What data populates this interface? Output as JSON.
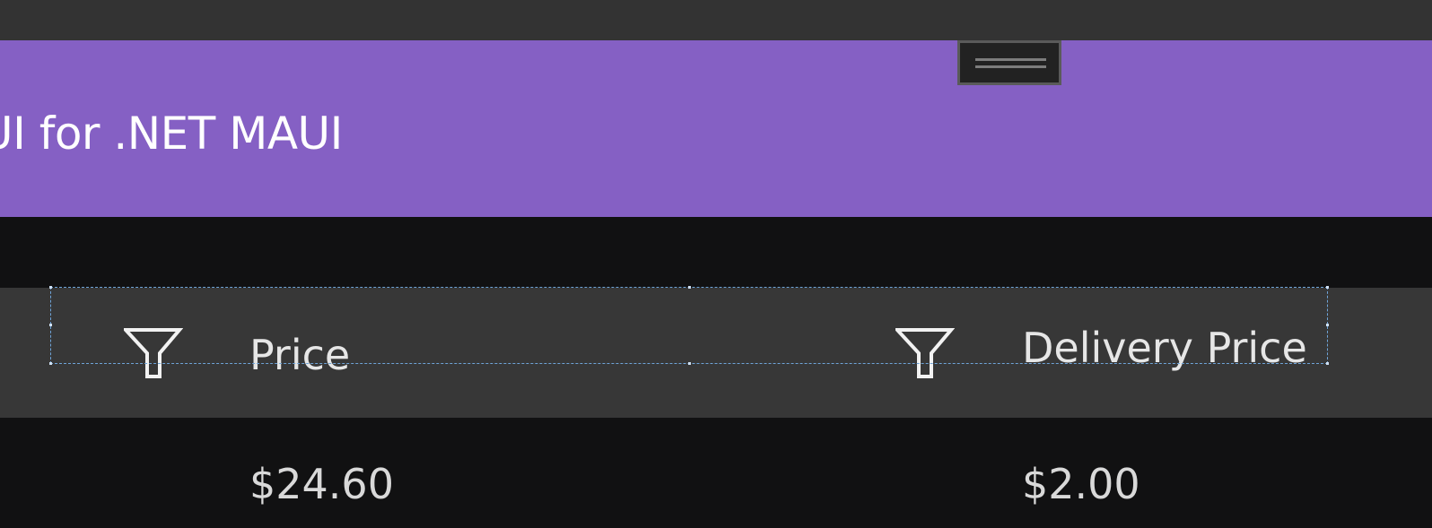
{
  "header": {
    "title": "UI for .NET MAUI",
    "accent_color": "#8560c4",
    "drag_handle_icon": "drag-handle-icon"
  },
  "grid": {
    "columns": [
      {
        "title": "Price",
        "filter_icon": "filter-icon"
      },
      {
        "title": "Delivery Price",
        "filter_icon": "filter-icon"
      }
    ],
    "rows": [
      {
        "price": "$24.60",
        "delivery_price": "$2.00"
      }
    ]
  }
}
